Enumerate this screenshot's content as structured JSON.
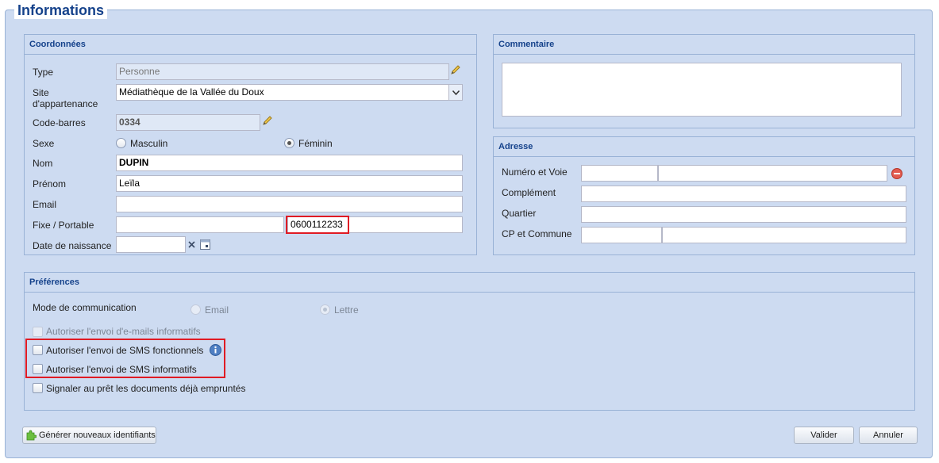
{
  "title": "Informations",
  "coordonnees": {
    "header": "Coordonnées",
    "type_label": "Type",
    "type_value": "Personne",
    "site_label_line1": "Site",
    "site_label_line2": "d'appartenance",
    "site_value": "Médiathèque de la Vallée du Doux",
    "code_barres_label": "Code-barres",
    "code_barres_value": "0334",
    "sexe_label": "Sexe",
    "sexe_option_masculin": "Masculin",
    "sexe_option_feminin": "Féminin",
    "sexe_selected": "Féminin",
    "nom_label": "Nom",
    "nom_value": "DUPIN",
    "prenom_label": "Prénom",
    "prenom_value": "Leïla",
    "email_label": "Email",
    "email_value": "",
    "telephone_label": "Fixe / Portable",
    "fixe_value": "",
    "portable_value": "0600112233",
    "naissance_label": "Date de naissance",
    "naissance_value": ""
  },
  "commentaire": {
    "header": "Commentaire",
    "value": ""
  },
  "adresse": {
    "header": "Adresse",
    "numero_voie_label": "Numéro et Voie",
    "complement_label": "Complément",
    "quartier_label": "Quartier",
    "cp_commune_label": "CP et Commune"
  },
  "preferences": {
    "header": "Préférences",
    "mode_label": "Mode de communication",
    "mode_option_email": "Email",
    "mode_option_lettre": "Lettre",
    "mode_selected": "Lettre",
    "chk_emails_informatifs": "Autoriser l'envoi d'e-mails informatifs",
    "chk_sms_fonctionnels": "Autoriser l'envoi de SMS fonctionnels",
    "chk_sms_informatifs": "Autoriser l'envoi de SMS informatifs",
    "chk_signaler_pret": "Signaler au prêt les documents déjà empruntés"
  },
  "buttons": {
    "generer": "Générer nouveaux identifiants",
    "valider": "Valider",
    "annuler": "Annuler"
  },
  "colors": {
    "panel_bg": "#cddbf1",
    "header_text": "#15428b",
    "highlight_red": "#e01b24"
  }
}
